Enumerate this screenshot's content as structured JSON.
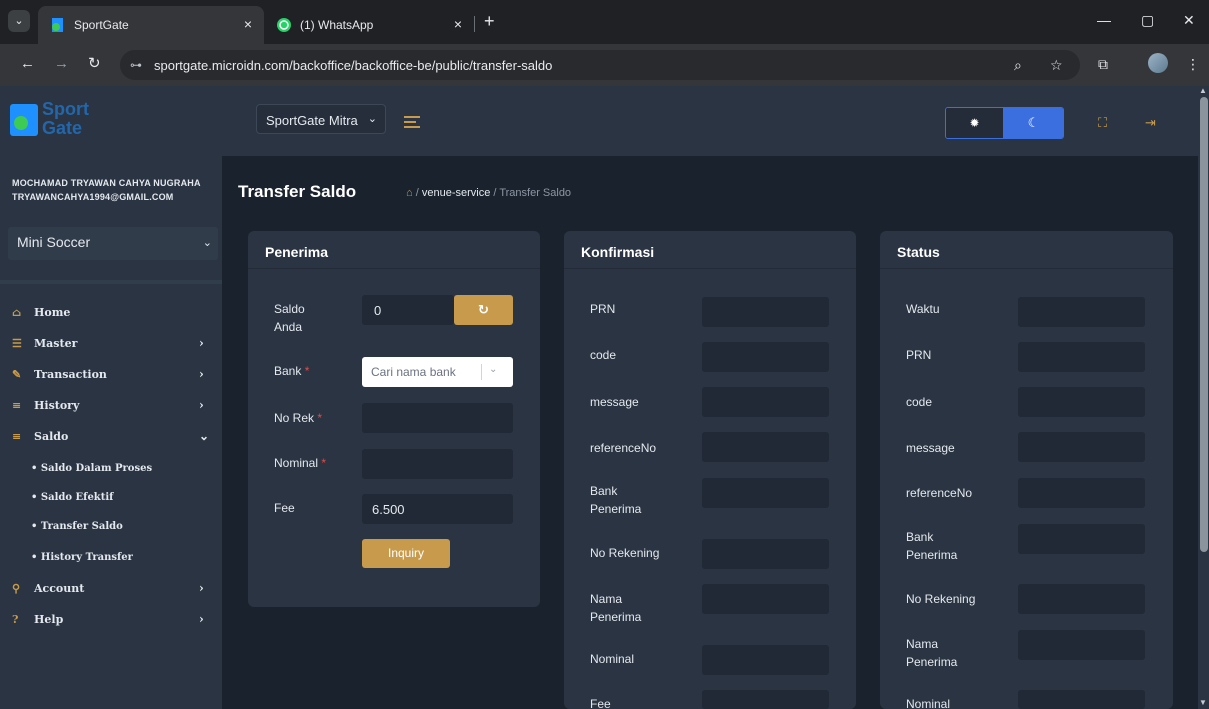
{
  "browser": {
    "tabs": [
      {
        "title": "SportGate",
        "close": "×"
      },
      {
        "title": "(1) WhatsApp",
        "close": "×"
      }
    ],
    "new_tab": "+",
    "url": "sportgate.microidn.com/backoffice/backoffice-be/public/transfer-saldo",
    "window_controls": {
      "minimize": "—",
      "restore": "▢",
      "close": "✕"
    },
    "nav": {
      "back": "←",
      "forward": "→",
      "reload": "↻"
    },
    "omnibox_icons": {
      "site_info": "⊶",
      "zoom": "⌕",
      "bookmark": "☆",
      "extensions": "⧉",
      "menu": "⋮"
    }
  },
  "app": {
    "logo_text_1": "Sport",
    "logo_text_2": "Gate",
    "mitra_select": "SportGate Mitra",
    "theme": {
      "light_icon": "✹",
      "dark_icon": "☾"
    },
    "header_icons": {
      "fullscreen": "⛶",
      "logout": "⇥"
    }
  },
  "sidebar": {
    "user_name": "MOCHAMAD TRYAWAN CAHYA NUGRAHA",
    "user_email": "TRYAWANCAHYA1994@GMAIL.COM",
    "sport_select": "Mini Soccer",
    "items": [
      {
        "label": "Home",
        "icon": "⌂",
        "arrow": ""
      },
      {
        "label": "Master",
        "icon": "☰",
        "arrow": "›"
      },
      {
        "label": "Transaction",
        "icon": "✎",
        "arrow": "›"
      },
      {
        "label": "History",
        "icon": "≡",
        "arrow": "›"
      },
      {
        "label": "Saldo",
        "icon": "≡",
        "arrow": "⌄"
      },
      {
        "label": "Account",
        "icon": "⚲",
        "arrow": "›"
      },
      {
        "label": "Help",
        "icon": "?",
        "arrow": "›"
      }
    ],
    "saldo_sub": [
      "Saldo Dalam Proses",
      "Saldo Efektif",
      "Transfer Saldo",
      "History Transfer"
    ]
  },
  "page": {
    "title": "Transfer Saldo",
    "breadcrumb": {
      "home_icon": "⌂",
      "sep": "/",
      "link": "venue-service",
      "current": "Transfer Saldo"
    }
  },
  "penerima": {
    "title": "Penerima",
    "saldo_label": "Saldo Anda",
    "saldo_value": "0",
    "refresh_icon": "↻",
    "bank_label": "Bank",
    "bank_placeholder": "Cari nama bank",
    "norek_label": "No Rek",
    "nominal_label": "Nominal",
    "fee_label": "Fee",
    "fee_value": "6.500",
    "required_mark": "*",
    "inquiry_label": "Inquiry"
  },
  "konfirmasi": {
    "title": "Konfirmasi",
    "fields": [
      "PRN",
      "code",
      "message",
      "referenceNo",
      "Bank Penerima",
      "No Rekening",
      "Nama Penerima",
      "Nominal",
      "Fee"
    ]
  },
  "status": {
    "title": "Status",
    "fields": [
      "Waktu",
      "PRN",
      "code",
      "message",
      "referenceNo",
      "Bank Penerima",
      "No Rekening",
      "Nama Penerima",
      "Nominal"
    ]
  }
}
